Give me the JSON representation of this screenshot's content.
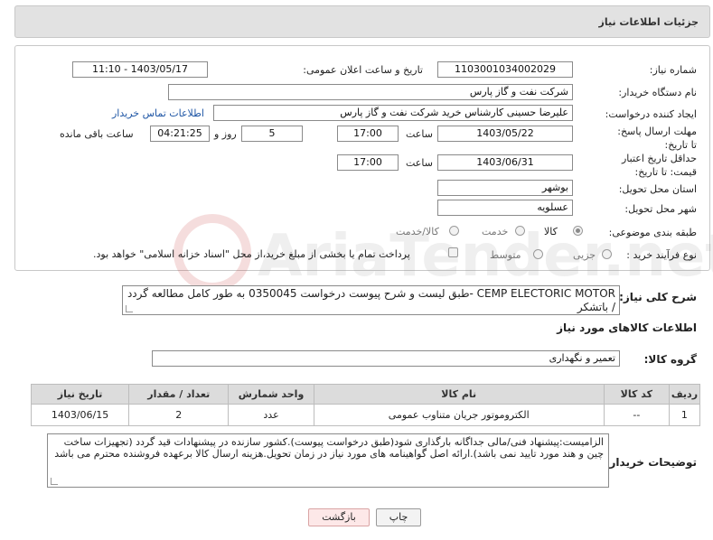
{
  "header": {
    "title": "جزئیات اطلاعات نیاز"
  },
  "form": {
    "need_number": {
      "label": "شماره نیاز:",
      "value": "1103001034002029"
    },
    "announce": {
      "label": "تاریخ و ساعت اعلان عمومی:",
      "value": "1403/05/17 - 11:10"
    },
    "buyer_org": {
      "label": "نام دستگاه خریدار:",
      "value": "شرکت نفت و گاز پارس"
    },
    "requester": {
      "label": "ایجاد کننده درخواست:",
      "value": "علیرضا حسینی کارشناس خرید شرکت نفت و گاز پارس",
      "contact_link": "اطلاعات تماس خریدار"
    },
    "deadline": {
      "label": "مهلت ارسال پاسخ: تا تاریخ:",
      "date": "1403/05/22",
      "time_label": "ساعت",
      "time": "17:00",
      "days": "5",
      "days_label": "روز و",
      "remaining": "04:21:25",
      "remaining_label": "ساعت باقی مانده"
    },
    "validity": {
      "label": "حداقل تاریخ اعتبار قیمت: تا تاریخ:",
      "date": "1403/06/31",
      "time_label": "ساعت",
      "time": "17:00"
    },
    "province": {
      "label": "استان محل تحویل:",
      "value": "بوشهر"
    },
    "city": {
      "label": "شهر محل تحویل:",
      "value": "عسلویه"
    },
    "category": {
      "label": "طبقه بندی موضوعی:",
      "options": [
        "کالا",
        "خدمت",
        "کالا/خدمت"
      ],
      "selected": "کالا"
    },
    "process": {
      "label": "نوع فرآیند خرید :",
      "options": [
        "جزیی",
        "متوسط"
      ],
      "payment_note": "پرداخت تمام یا بخشی از مبلغ خرید،از محل \"اسناد خزانه اسلامی\" خواهد بود."
    }
  },
  "description": {
    "label": "شرح کلی نیاز:",
    "value": "CEMP ELECTORIC MOTOR -طبق لیست و شرح پیوست درخواست 0350045 به طور کامل مطالعه گردد / باتشکر"
  },
  "goods": {
    "section_title": "اطلاعات کالاهای مورد نیاز",
    "group_label": "گروه کالا:",
    "group_value": "تعمیر و نگهداری",
    "columns": [
      "ردیف",
      "کد کالا",
      "نام کالا",
      "واحد شمارش",
      "تعداد / مقدار",
      "تاریخ نیاز"
    ],
    "rows": [
      {
        "row": "1",
        "code": "--",
        "name": "الکتروموتور جریان متناوب عمومی",
        "unit": "عدد",
        "qty": "2",
        "date": "1403/06/15"
      }
    ]
  },
  "buyer_notes": {
    "label": "توضیحات خریدار:",
    "value": "الزامیست:پیشنهاد فنی/مالی جداگانه بارگذاری شود(طبق درخواست پیوست).کشور سازنده در پیشنهادات قید گردد (تجهیزات ساخت چین و هند مورد تایید نمی باشد).ارائه اصل گواهینامه های مورد نیاز در زمان تحویل.هزینه ارسال کالا برعهده فروشنده محترم می باشد"
  },
  "buttons": {
    "print": "چاپ",
    "back": "بازگشت"
  },
  "watermark": {
    "text": "AriaTender.net"
  }
}
